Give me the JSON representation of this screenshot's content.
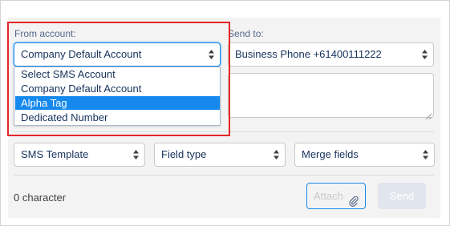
{
  "from_account": {
    "label": "From account:",
    "selected": "Company Default Account",
    "options": [
      "Select SMS Account",
      "Company Default Account",
      "Alpha Tag",
      "Dedicated Number"
    ],
    "highlighted_option": "Alpha Tag"
  },
  "send_to": {
    "label": "Send to:",
    "selected": "Business Phone +61400111222"
  },
  "toolbar": {
    "sms_template": "SMS Template",
    "field_type": "Field type",
    "merge_fields": "Merge fields"
  },
  "footer": {
    "char_count": "0 character",
    "attach_label": "Attach",
    "send_label": "Send"
  },
  "colors": {
    "accent": "#1589ee",
    "highlight_border": "#e5262a",
    "panel_bg": "#f3f3f3"
  },
  "icons": [
    "select-arrows-icon",
    "paperclip-icon",
    "resize-grip-icon"
  ]
}
